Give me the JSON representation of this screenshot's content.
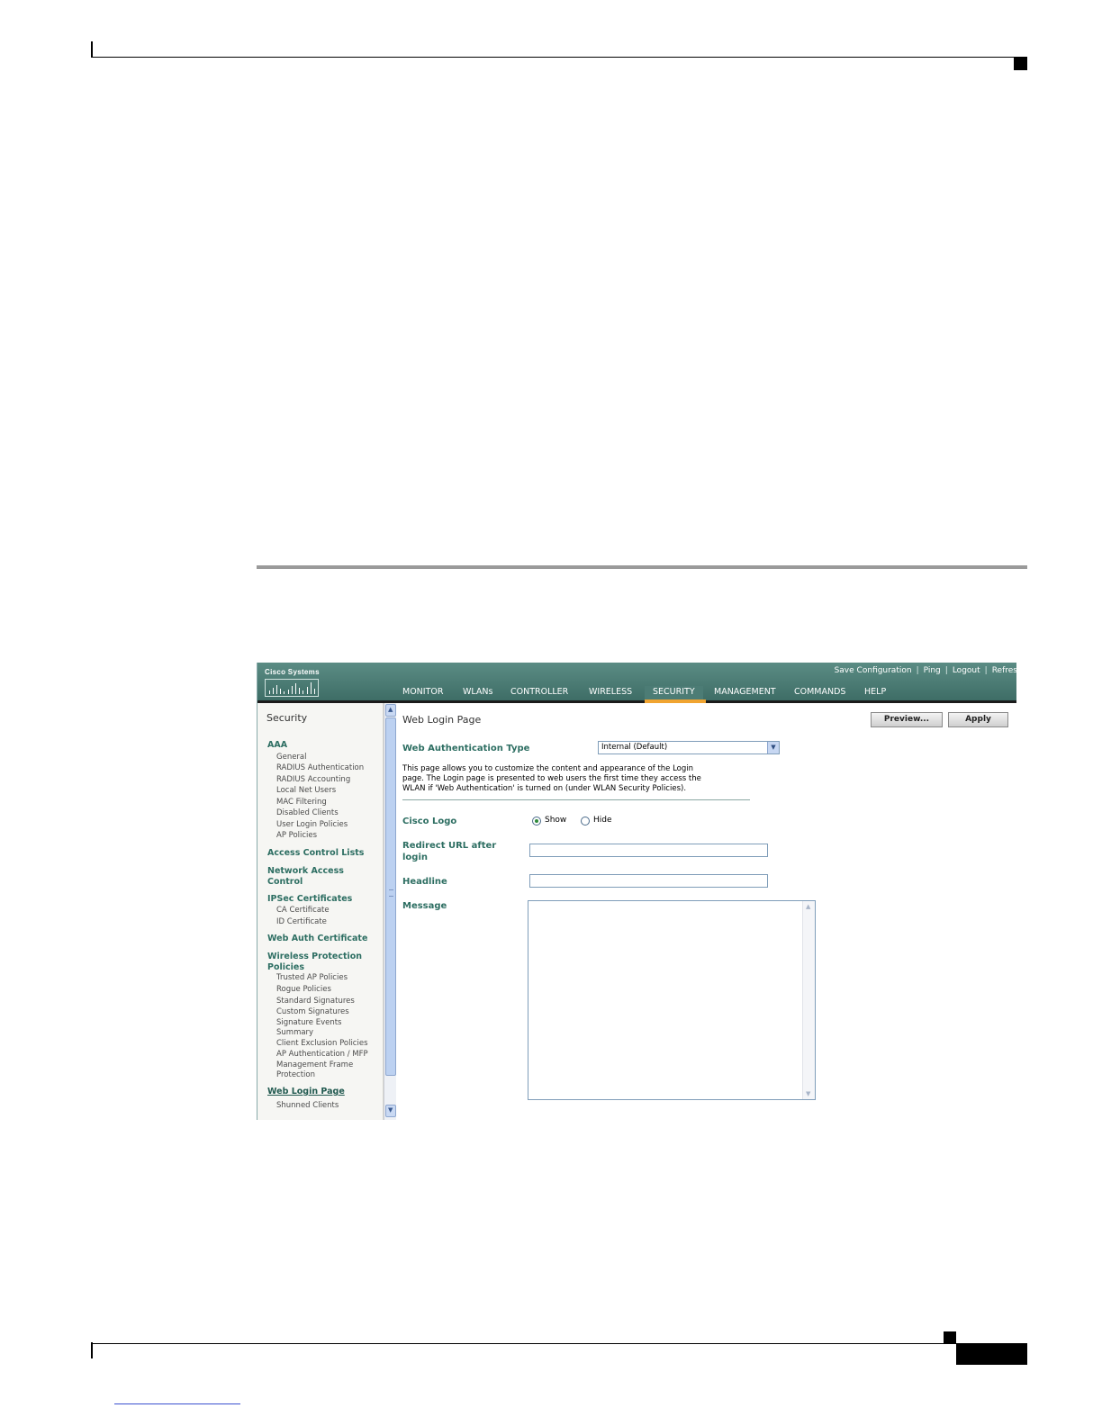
{
  "figure_id": "155867",
  "app": {
    "logo_text": "Cisco Systems",
    "top_links": [
      "Save Configuration",
      "Ping",
      "Logout",
      "Refres"
    ],
    "nav": [
      "MONITOR",
      "WLANs",
      "CONTROLLER",
      "WIRELESS",
      "SECURITY",
      "MANAGEMENT",
      "COMMANDS",
      "HELP"
    ],
    "active_nav": "SECURITY",
    "accent_color": "#f0a431",
    "header_color": "#4a7b74"
  },
  "sidebar": {
    "title": "Security",
    "aaa": "AAA",
    "aaa_items": [
      "General",
      "RADIUS Authentication",
      "RADIUS Accounting",
      "Local Net Users",
      "MAC Filtering",
      "Disabled Clients",
      "User Login Policies",
      "AP Policies"
    ],
    "acl": "Access Control Lists",
    "nac_1": "Network Access",
    "nac_2": "Control",
    "ipsec": "IPSec Certificates",
    "ipsec_items": [
      "CA Certificate",
      "ID Certificate"
    ],
    "webauth_cert": "Web Auth Certificate",
    "wpp_1": "Wireless Protection",
    "wpp_2": "Policies",
    "wpp_items": [
      "Trusted AP Policies",
      "Rogue Policies",
      "Standard Signatures",
      "Custom Signatures",
      "Signature Events",
      "Summary",
      "Client Exclusion Policies",
      "AP Authentication / MFP",
      "Management Frame",
      "Protection"
    ],
    "web_login": "Web Login Page",
    "shunned": "Shunned Clients"
  },
  "main": {
    "title": "Web Login Page",
    "preview_button": "Preview...",
    "apply_button": "Apply",
    "auth_type_label": "Web Authentication Type",
    "auth_type_value": "Internal (Default)",
    "description_lines": [
      "This page allows you to customize the content and appearance of the Login",
      "page. The Login page is presented to web users the first time they access the",
      "WLAN if 'Web Authentication' is turned on (under WLAN Security Policies)."
    ],
    "cisco_logo_label": "Cisco Logo",
    "show_label": "Show",
    "hide_label": "Hide",
    "cisco_logo_selected": "Show",
    "redirect_label_1": "Redirect URL after",
    "redirect_label_2": "login",
    "redirect_value": "",
    "headline_label": "Headline",
    "headline_value": "",
    "message_label": "Message",
    "message_value": ""
  }
}
